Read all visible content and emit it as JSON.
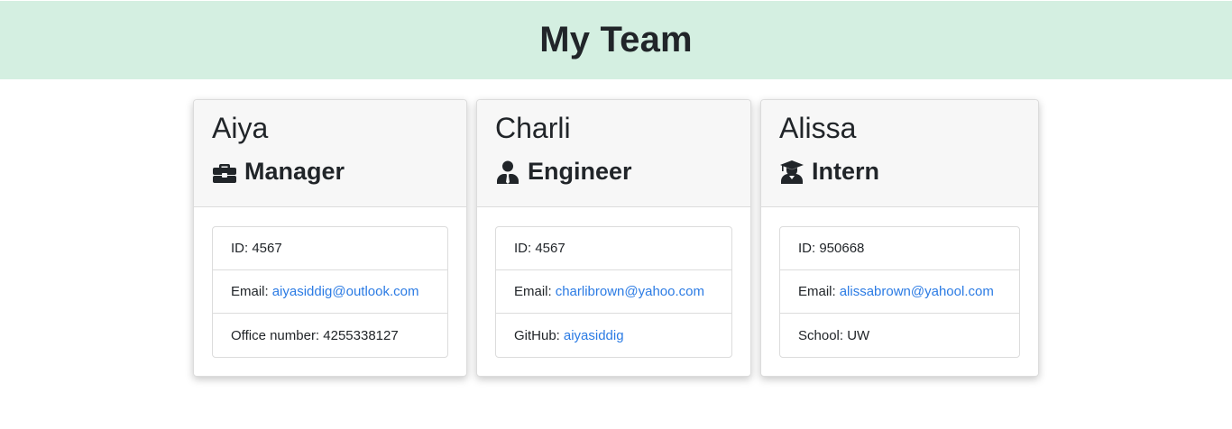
{
  "page": {
    "title": "My Team"
  },
  "colors": {
    "header_bg": "#d4efe1",
    "link": "#2b7be4",
    "card_header_bg": "#f7f7f7"
  },
  "cards": [
    {
      "name": "Aiya",
      "role": "Manager",
      "role_icon": "briefcase-icon",
      "id_label": "ID:",
      "id_value": "4567",
      "email_label": "Email:",
      "email": "aiyasiddig@outlook.com",
      "extra_label": "Office number:",
      "extra_value": "4255338127"
    },
    {
      "name": "Charli",
      "role": "Engineer",
      "role_icon": "user-tie-icon",
      "id_label": "ID:",
      "id_value": "4567",
      "email_label": "Email:",
      "email": "charlibrown@yahoo.com",
      "extra_label": "GitHub:",
      "extra_value": "aiyasiddig"
    },
    {
      "name": "Alissa",
      "role": "Intern",
      "role_icon": "user-graduate-icon",
      "id_label": "ID:",
      "id_value": "950668",
      "email_label": "Email:",
      "email": "alissabrown@yahool.com",
      "extra_label": "School:",
      "extra_value": "UW"
    }
  ]
}
